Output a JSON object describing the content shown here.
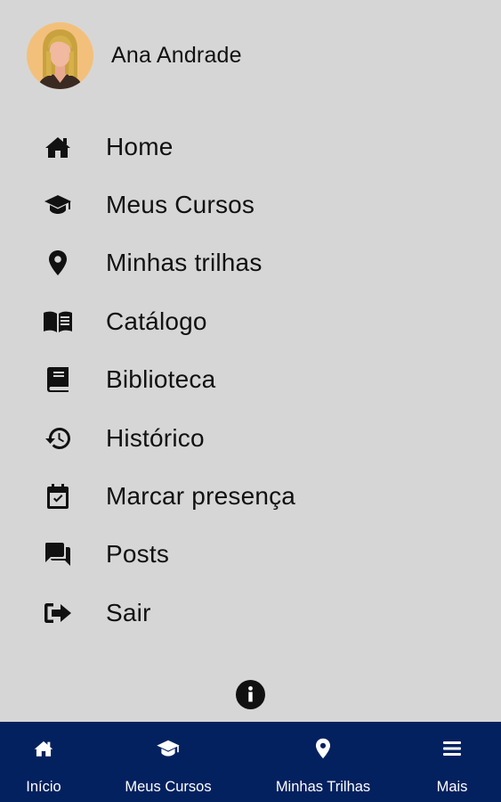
{
  "profile": {
    "name": "Ana Andrade",
    "avatar_bg": "#f3c07b"
  },
  "menu": {
    "items": [
      {
        "label": "Home",
        "icon": "home-icon"
      },
      {
        "label": "Meus Cursos",
        "icon": "graduation-cap-icon"
      },
      {
        "label": "Minhas trilhas",
        "icon": "map-pin-icon"
      },
      {
        "label": "Catálogo",
        "icon": "open-book-icon"
      },
      {
        "label": "Biblioteca",
        "icon": "book-icon"
      },
      {
        "label": "Histórico",
        "icon": "history-icon"
      },
      {
        "label": "Marcar presença",
        "icon": "calendar-check-icon"
      },
      {
        "label": "Posts",
        "icon": "chat-icon"
      },
      {
        "label": "Sair",
        "icon": "sign-out-icon"
      }
    ]
  },
  "info": {
    "icon": "info-icon"
  },
  "bottom_nav": {
    "background": "#04215f",
    "items": [
      {
        "label": "Início",
        "icon": "home-icon"
      },
      {
        "label": "Meus Cursos",
        "icon": "graduation-cap-icon"
      },
      {
        "label": "Minhas Trilhas",
        "icon": "map-pin-icon"
      },
      {
        "label": "Mais",
        "icon": "menu-icon"
      }
    ]
  }
}
